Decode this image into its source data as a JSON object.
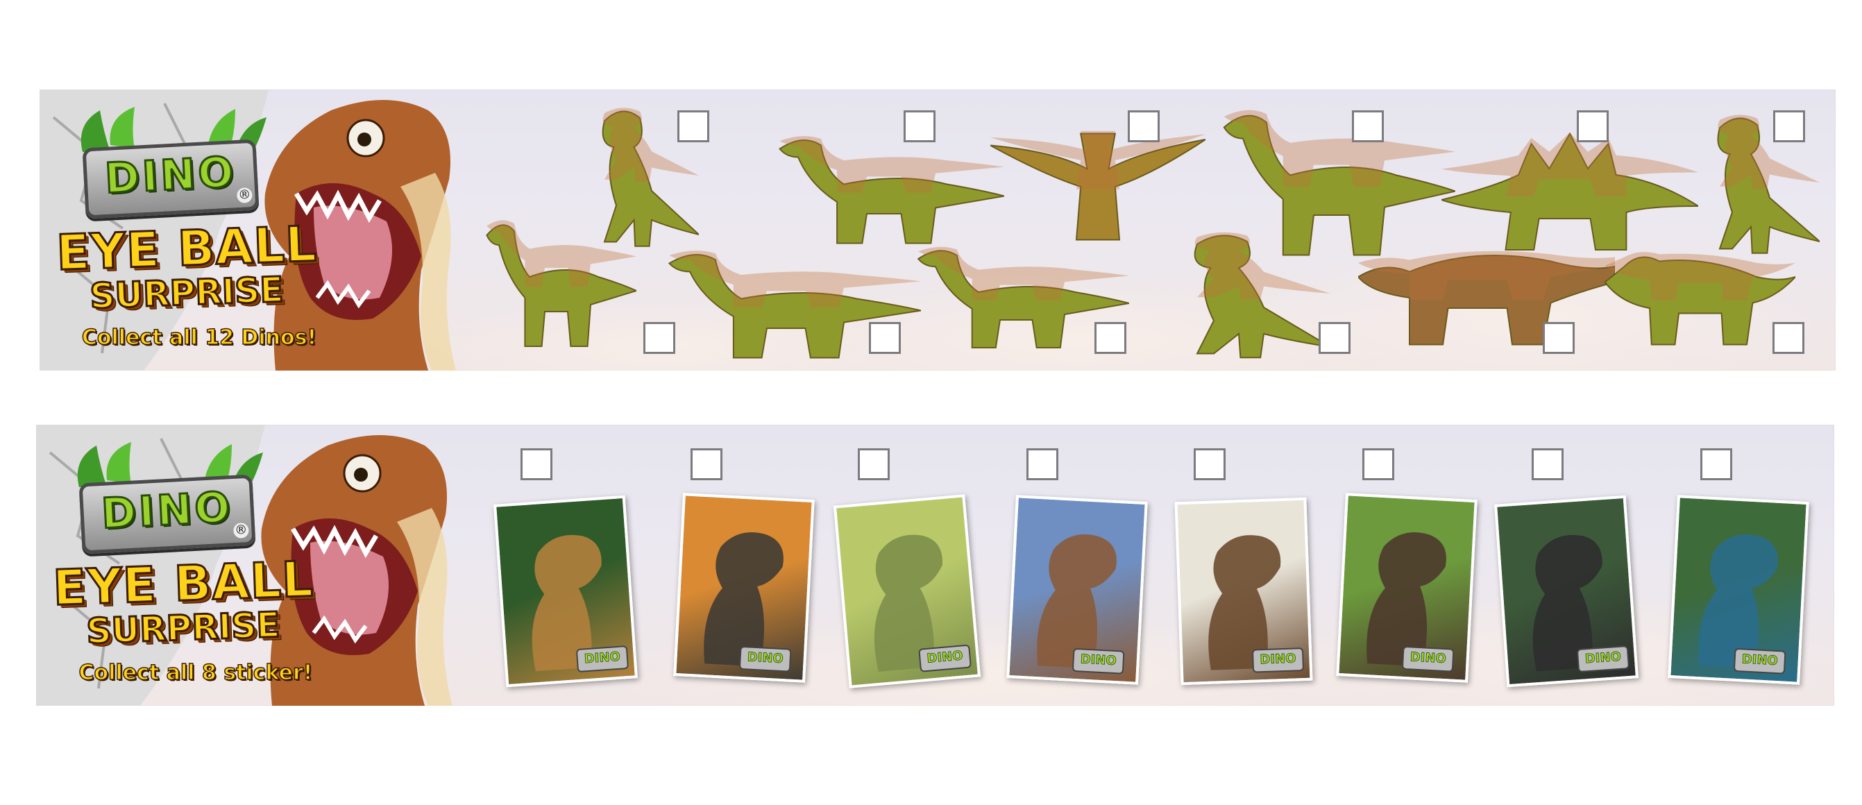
{
  "brand": {
    "logo_text": "DINO",
    "registered_mark": "®",
    "title_line1": "EYE BALL",
    "title_line2": "SURPRISE"
  },
  "strips": [
    {
      "id": "figures",
      "tagline": "Collect all 12 Dinos!",
      "items": [
        {
          "name": "t-rex-standing",
          "color": "#8f9a2c"
        },
        {
          "name": "iguanodon",
          "color": "#8f9a2c"
        },
        {
          "name": "pteranodon",
          "color": "#a7852e"
        },
        {
          "name": "gallimimus",
          "color": "#8f9a2c"
        },
        {
          "name": "stegosaurus",
          "color": "#8f9a2c"
        },
        {
          "name": "parasaurolophus",
          "color": "#8f9a2c"
        },
        {
          "name": "baby-sauropod",
          "color": "#8f9a2c"
        },
        {
          "name": "spinosaurus",
          "color": "#8f9a2c"
        },
        {
          "name": "brachiosaurus",
          "color": "#8f9a2c"
        },
        {
          "name": "raptor",
          "color": "#8f9a2c"
        },
        {
          "name": "ankylosaurus",
          "color": "#9a6c38"
        },
        {
          "name": "triceratops",
          "color": "#8f9a2c"
        }
      ]
    },
    {
      "id": "stickers",
      "tagline": "Collect all 8 sticker!",
      "items": [
        {
          "name": "sticker-jungle-trex",
          "logo": "DINO",
          "colors": [
            "#2f5a2a",
            "#b3803c"
          ]
        },
        {
          "name": "sticker-sunset-raptor",
          "logo": "DINO",
          "colors": [
            "#d98a33",
            "#3f3b33"
          ]
        },
        {
          "name": "sticker-green-roar",
          "logo": "DINO",
          "colors": [
            "#b9c96a",
            "#7d8f4a"
          ]
        },
        {
          "name": "sticker-canyon-spino",
          "logo": "DINO",
          "colors": [
            "#6f8fc2",
            "#8a5b3a"
          ]
        },
        {
          "name": "sticker-hatching-eggs",
          "logo": "DINO",
          "colors": [
            "#e8e4d8",
            "#6b4a2f"
          ]
        },
        {
          "name": "sticker-meadow-trex",
          "logo": "DINO",
          "colors": [
            "#6c9a3d",
            "#4d3a2c"
          ]
        },
        {
          "name": "sticker-dark-raptor",
          "logo": "DINO",
          "colors": [
            "#3c5a3a",
            "#2d2d2d"
          ]
        },
        {
          "name": "sticker-blue-trex",
          "logo": "DINO",
          "colors": [
            "#3e6b3a",
            "#2a6d8c"
          ]
        }
      ]
    }
  ]
}
